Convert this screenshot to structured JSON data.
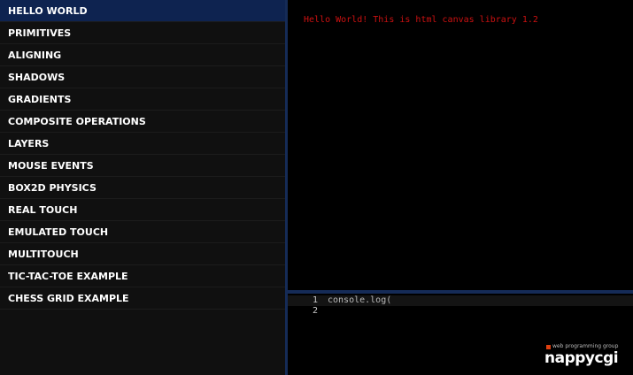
{
  "sidebar": {
    "items": [
      {
        "label": "HELLO WORLD",
        "active": true
      },
      {
        "label": "PRIMITIVES",
        "active": false
      },
      {
        "label": "ALIGNING",
        "active": false
      },
      {
        "label": "SHADOWS",
        "active": false
      },
      {
        "label": "GRADIENTS",
        "active": false
      },
      {
        "label": "COMPOSITE OPERATIONS",
        "active": false
      },
      {
        "label": "LAYERS",
        "active": false
      },
      {
        "label": "MOUSE EVENTS",
        "active": false
      },
      {
        "label": "BOX2D PHYSICS",
        "active": false
      },
      {
        "label": "REAL TOUCH",
        "active": false
      },
      {
        "label": "EMULATED TOUCH",
        "active": false
      },
      {
        "label": "MULTITOUCH",
        "active": false
      },
      {
        "label": "TIC-TAC-TOE EXAMPLE",
        "active": false
      },
      {
        "label": "CHESS GRID EXAMPLE",
        "active": false
      }
    ]
  },
  "canvas": {
    "output_text": "Hello World! This is html canvas library 1.2"
  },
  "editor": {
    "lines": [
      {
        "number": "1",
        "code": "console.log(",
        "current": true
      },
      {
        "number": "2",
        "code": "",
        "current": false
      }
    ]
  },
  "logo": {
    "tagline": "web programming group",
    "wordmark": "nappycgi"
  },
  "colors": {
    "accent": "#152b57",
    "active_item": "#0e2350",
    "output_text": "#cc1111",
    "logo_mark": "#e04010"
  }
}
